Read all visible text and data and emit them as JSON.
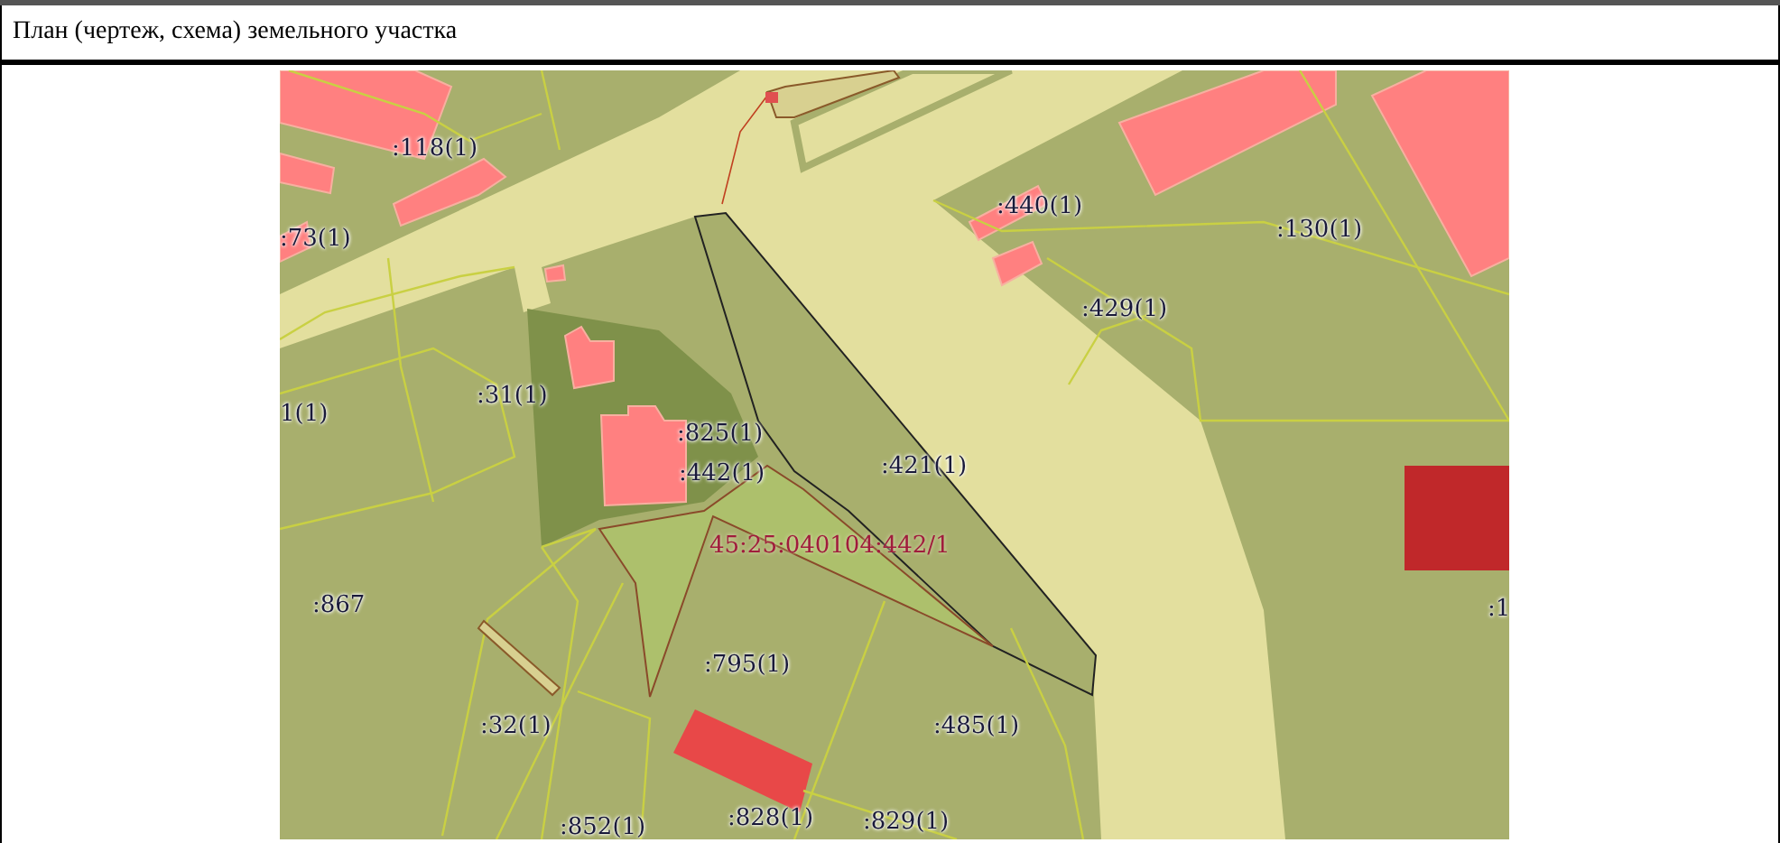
{
  "section": {
    "title": "План (чертеж, схема) земельного участка"
  },
  "map": {
    "labels": [
      {
        "text": ":118(1)",
        "kind": "parcel"
      },
      {
        "text": ":73(1)",
        "kind": "parcel"
      },
      {
        "text": ":31(1)",
        "kind": "parcel"
      },
      {
        "text": "1(1)",
        "kind": "parcel"
      },
      {
        "text": ":825(1)",
        "kind": "parcel"
      },
      {
        "text": ":442(1)",
        "kind": "parcel"
      },
      {
        "text": ":421(1)",
        "kind": "parcel"
      },
      {
        "text": "45:25:040104:442/1",
        "kind": "target"
      },
      {
        "text": ":867",
        "kind": "parcel"
      },
      {
        "text": ":795(1)",
        "kind": "parcel"
      },
      {
        "text": ":32(1)",
        "kind": "parcel"
      },
      {
        "text": ":485(1)",
        "kind": "parcel"
      },
      {
        "text": ":852(1)",
        "kind": "parcel"
      },
      {
        "text": ":828(1)",
        "kind": "parcel"
      },
      {
        "text": ":829(1)",
        "kind": "parcel"
      },
      {
        "text": ":440(1)",
        "kind": "parcel"
      },
      {
        "text": ":130(1)",
        "kind": "parcel"
      },
      {
        "text": ":429(1)",
        "kind": "parcel"
      },
      {
        "text": ":1",
        "kind": "parcel"
      }
    ]
  }
}
